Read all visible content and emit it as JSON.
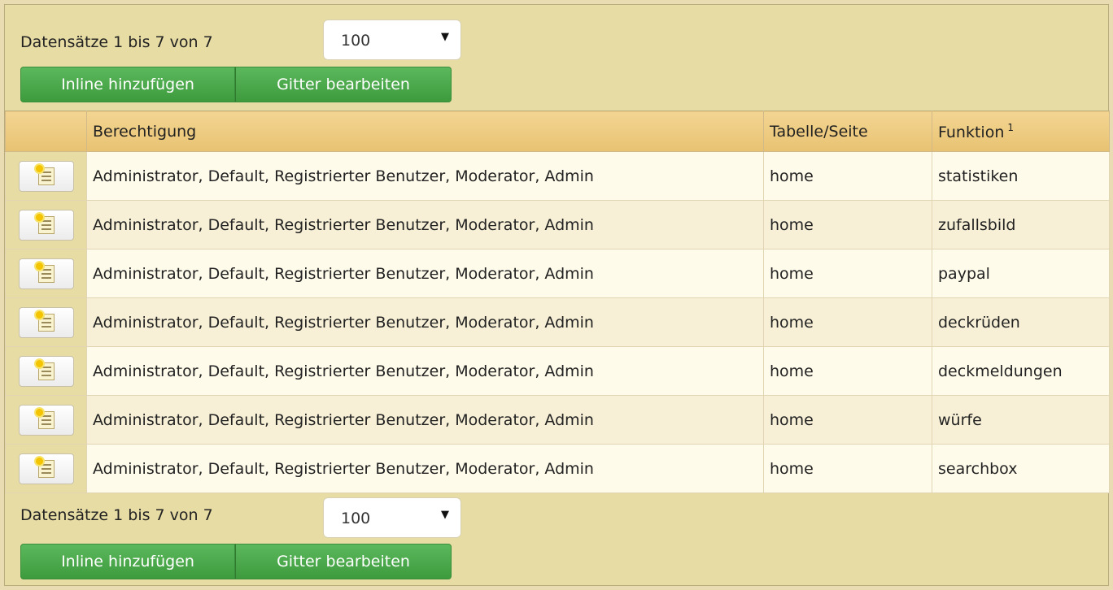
{
  "pager_top": {
    "count_text": "Datensätze 1 bis 7 von 7",
    "page_size": "100",
    "add_inline_label": "Inline hinzufügen",
    "grid_edit_label": "Gitter bearbeiten"
  },
  "pager_bottom": {
    "count_text": "Datensätze 1 bis 7 von 7",
    "page_size": "100",
    "add_inline_label": "Inline hinzufügen",
    "grid_edit_label": "Gitter bearbeiten"
  },
  "table": {
    "columns": {
      "permission": "Berechtigung",
      "table_page": "Tabelle/Seite",
      "function": "Funktion",
      "function_sort_index": "1"
    },
    "rows": [
      {
        "permission": "Administrator, Default, Registrierter Benutzer, Moderator, Admin",
        "table_page": "home",
        "function": "statistiken"
      },
      {
        "permission": "Administrator, Default, Registrierter Benutzer, Moderator, Admin",
        "table_page": "home",
        "function": "zufallsbild"
      },
      {
        "permission": "Administrator, Default, Registrierter Benutzer, Moderator, Admin",
        "table_page": "home",
        "function": "paypal"
      },
      {
        "permission": "Administrator, Default, Registrierter Benutzer, Moderator, Admin",
        "table_page": "home",
        "function": "deckrüden"
      },
      {
        "permission": "Administrator, Default, Registrierter Benutzer, Moderator, Admin",
        "table_page": "home",
        "function": "deckmeldungen"
      },
      {
        "permission": "Administrator, Default, Registrierter Benutzer, Moderator, Admin",
        "table_page": "home",
        "function": "würfe"
      },
      {
        "permission": "Administrator, Default, Registrierter Benutzer, Moderator, Admin",
        "table_page": "home",
        "function": "searchbox"
      }
    ],
    "row_action_icon": "edit-document-icon"
  },
  "colors": {
    "background": "#e7dca4",
    "header": "#f3d592",
    "button_green": "#5cb85c"
  }
}
